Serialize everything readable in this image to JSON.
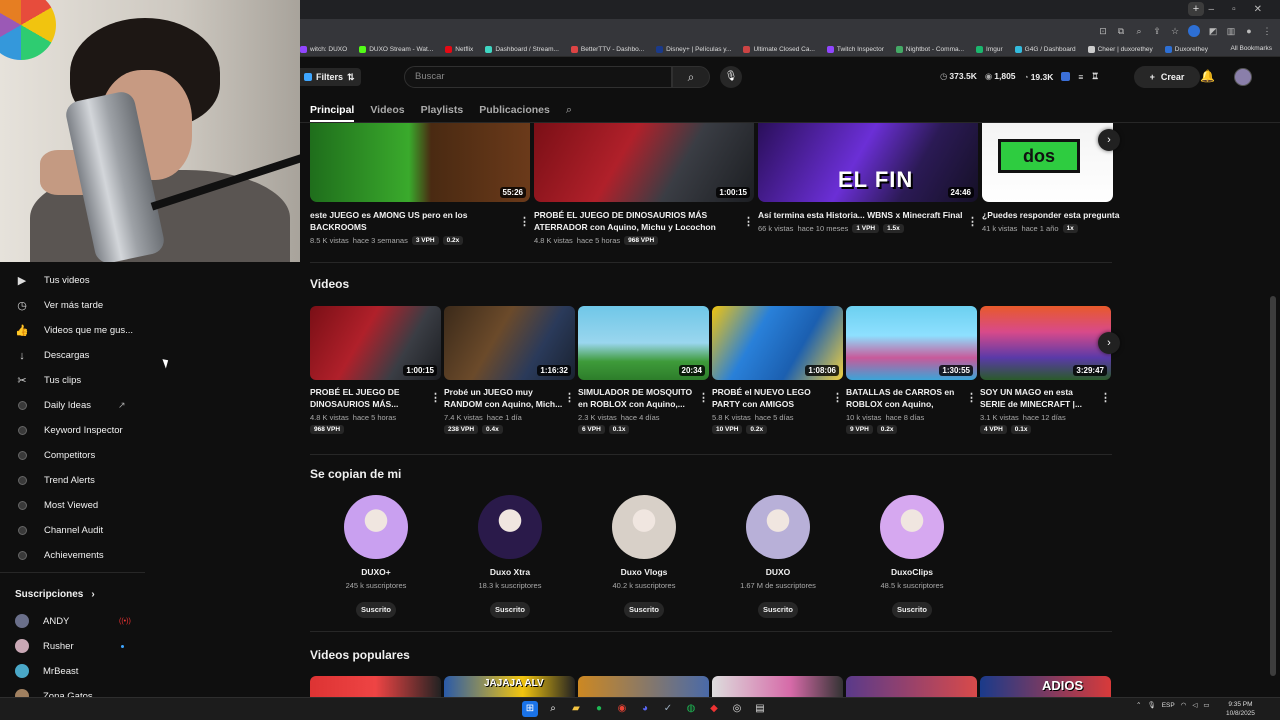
{
  "browser": {
    "bookmarks": [
      {
        "label": "witch: DUXO",
        "color": "#9146ff"
      },
      {
        "label": "DUXO Stream - Wat...",
        "color": "#53fc18"
      },
      {
        "label": "Netflix",
        "color": "#e50914"
      },
      {
        "label": "Dashboard / Stream...",
        "color": "#3fd6c2"
      },
      {
        "label": "BetterTTV - Dashbo...",
        "color": "#d44"
      },
      {
        "label": "Disney+ | Películas y...",
        "color": "#1a3a8a"
      },
      {
        "label": "Ultimate Closed Ca...",
        "color": "#c44"
      },
      {
        "label": "Twitch Inspector",
        "color": "#9146ff"
      },
      {
        "label": "Nightbot - Comma...",
        "color": "#4a6"
      },
      {
        "label": "Imgur",
        "color": "#1bb76e"
      },
      {
        "label": "G4G / Dashboard",
        "color": "#3bd"
      },
      {
        "label": "Cheer | duxorethey",
        "color": "#ccc"
      },
      {
        "label": "Duxorethey",
        "color": "#2d6fd4"
      }
    ],
    "all_bookmarks": "All Bookmarks"
  },
  "header": {
    "filters_label": "Filters",
    "search_placeholder": "Buscar",
    "stats": {
      "views": "373.5K",
      "subs": "1,805",
      "watch": "19.3K"
    },
    "create_label": "Crear"
  },
  "tabs": [
    "Principal",
    "Videos",
    "Playlists",
    "Publicaciones"
  ],
  "sidebar": {
    "items": [
      {
        "icon": "▶",
        "label": "Tus videos"
      },
      {
        "icon": "◷",
        "label": "Ver más tarde"
      },
      {
        "icon": "👍",
        "label": "Videos que me gus..."
      },
      {
        "icon": "↓",
        "label": "Descargas"
      },
      {
        "icon": "✂",
        "label": "Tus clips"
      }
    ],
    "extensions": [
      {
        "label": "Daily Ideas",
        "external": "↗"
      },
      {
        "label": "Keyword Inspector",
        "external": ""
      },
      {
        "label": "Competitors",
        "external": ""
      },
      {
        "label": "Trend Alerts",
        "external": ""
      },
      {
        "label": "Most Viewed",
        "external": ""
      },
      {
        "label": "Channel Audit",
        "external": ""
      },
      {
        "label": "Achievements",
        "external": ""
      }
    ],
    "subscriptions_label": "Suscripciones",
    "subscriptions": [
      {
        "name": "ANDY",
        "color": "#6a6f8a",
        "live": "((•))"
      },
      {
        "name": "Rusher",
        "color": "#c9a8b5",
        "live": ""
      },
      {
        "name": "MrBeast",
        "color": "#4aa8c8",
        "live": ""
      },
      {
        "name": "Zona Gatos",
        "color": "#a08060",
        "live": ""
      }
    ]
  },
  "row1": [
    {
      "title": "este JUEGO es AMONG US pero en los BACKROOMS",
      "duration": "55:26",
      "views": "8.5 K vistas",
      "age": "hace 3 semanas",
      "vph": "3 VPH",
      "ratio": "0.2x",
      "bg": "linear-gradient(90deg,#1f6e1c 0%,#3aaa2c 45%,#4a2a12 55%,#6b3a1a 100%)"
    },
    {
      "title": "PROBÉ EL JUEGO DE DINOSAURIOS MÁS ATERRADOR con Aquino, Michu y Locochon",
      "duration": "1:00:15",
      "views": "4.8 K vistas",
      "age": "hace 5 horas",
      "vph": "968 VPH",
      "ratio": "",
      "bg": "linear-gradient(120deg,#7a0f16 0%,#b0202a 40%,#3a3d44 65%,#1c1e22 100%)"
    },
    {
      "title": "Así termina esta Historia... WBNS x Minecraft Final",
      "duration": "24:46",
      "views": "66 k vistas",
      "age": "hace 10 meses",
      "vph": "1 VPH",
      "ratio": "1.5x",
      "bg": "linear-gradient(120deg,#2a0f5a 0%,#6b2fd6 45%,#2b1a55 70%,#151026 100%)",
      "overlay": "EL FIN"
    },
    {
      "title": "¿Puedes responder esta pregunta",
      "duration": "",
      "views": "41 k vistas",
      "age": "hace 1 año",
      "vph": "1x",
      "ratio": "",
      "bg": "linear-gradient(180deg,#f4f4f4 0%,#ffffff 100%)",
      "overlay": "dos"
    }
  ],
  "videos_section": "Videos",
  "videos": [
    {
      "title": "PROBÉ EL JUEGO DE DINOSAURIOS MÁS...",
      "duration": "1:00:15",
      "views": "4.8 K vistas",
      "age": "hace 5 horas",
      "vph": "968 VPH",
      "ratio": "",
      "bg": "linear-gradient(120deg,#7a0f16 0%,#b0202a 40%,#3a3d44 70%,#1c1e22 100%)"
    },
    {
      "title": "Probé un JUEGO muy RANDOM con Aquino, Mich...",
      "duration": "1:16:32",
      "views": "7.4 K vistas",
      "age": "hace 1 día",
      "vph": "238 VPH",
      "ratio": "0.4x",
      "bg": "linear-gradient(120deg,#3b2a1a 0%,#6b4a2a 40%,#2a3a5a 70%,#1a2230 100%)"
    },
    {
      "title": "SIMULADOR DE MOSQUITO en ROBLOX con Aquino,...",
      "duration": "20:34",
      "views": "2.3 K vistas",
      "age": "hace 4 días",
      "vph": "6 VPH",
      "ratio": "0.1x",
      "bg": "linear-gradient(180deg,#6fc7e8 0%,#9ad6ee 50%,#3e9b3a 75%,#2d7d2a 100%)"
    },
    {
      "title": "PROBÉ el NUEVO LEGO PARTY con AMIGOS",
      "duration": "1:08:06",
      "views": "5.8 K vistas",
      "age": "hace 5 días",
      "vph": "10 VPH",
      "ratio": "0.2x",
      "bg": "linear-gradient(120deg,#f1c40f 0%,#2980d9 35%,#1b5fb0 65%,#f0d040 100%)"
    },
    {
      "title": "BATALLAS de CARROS en ROBLOX con Aquino, Natala...",
      "duration": "1:30:55",
      "views": "10 k vistas",
      "age": "hace 8 días",
      "vph": "9 VPH",
      "ratio": "0.2x",
      "bg": "linear-gradient(180deg,#6cd0f0 0%,#8ee0ff 40%,#c85a9a 70%,#3aa5d8 100%)"
    },
    {
      "title": "SOY UN MAGO en esta SERIE de MINECRAFT |...",
      "duration": "3:29:47",
      "views": "3.1 K vistas",
      "age": "hace 12 días",
      "vph": "4 VPH",
      "ratio": "0.1x",
      "bg": "linear-gradient(180deg,#e85a2a 0%,#d84a8a 35%,#5a3aa8 70%,#2a5a2a 100%)"
    }
  ],
  "copy_section": "Se copian de mi",
  "channels": [
    {
      "name": "DUXO+",
      "subs": "245 k suscriptores",
      "button": "Suscrito",
      "bg": "#c9a0f0"
    },
    {
      "name": "Duxo Xtra",
      "subs": "18.3 k suscriptores",
      "button": "Suscrito",
      "bg": "#2a1a4a"
    },
    {
      "name": "Duxo Vlogs",
      "subs": "40.2 k suscriptores",
      "button": "Suscrito",
      "bg": "#d8d0c8"
    },
    {
      "name": "DUXO",
      "subs": "1.67 M de suscriptores",
      "button": "Suscrito",
      "bg": "#b8b0d8"
    },
    {
      "name": "DuxoClips",
      "subs": "48.5 k suscriptores",
      "button": "Suscrito",
      "bg": "#d6a8f0"
    }
  ],
  "popular_section": "Videos populares",
  "popular_thumbs": [
    {
      "bg": "linear-gradient(90deg,#d33 0%,#e44 50%,#222 100%)",
      "text": ""
    },
    {
      "bg": "linear-gradient(90deg,#2a5aa8 0%,#f1c40f 60%,#222 100%)",
      "text": "JAJAJA ALV"
    },
    {
      "bg": "linear-gradient(90deg,#c82 0%,#4a6aa8 100%)",
      "text": ""
    },
    {
      "bg": "linear-gradient(90deg,#ddd 0%,#d66aa8 60%,#333 100%)",
      "text": ""
    },
    {
      "bg": "linear-gradient(90deg,#5a3a8a 0%,#d84a4a 100%)",
      "text": ""
    },
    {
      "bg": "linear-gradient(90deg,#1a3a8a 0%,#d83a3a 100%)",
      "text": "ADIOS"
    }
  ],
  "taskbar": {
    "lang": "ESP",
    "time": "9:35 PM",
    "date": "10/8/2025"
  }
}
